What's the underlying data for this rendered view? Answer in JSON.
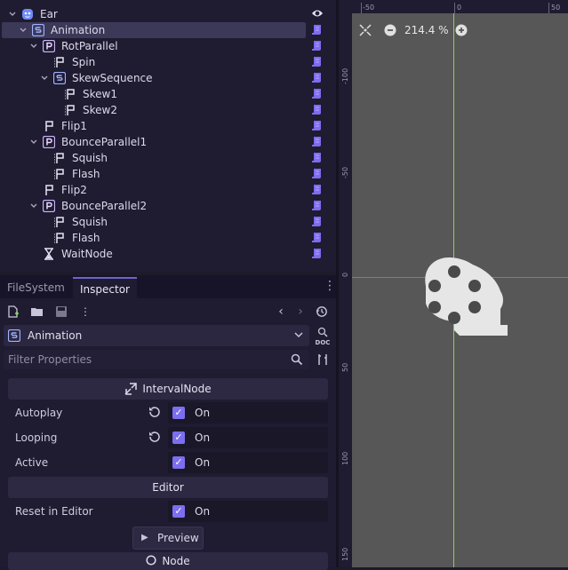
{
  "scene_tree": {
    "nodes": [
      {
        "label": "Ear",
        "depth": 0,
        "expand": "open",
        "icon": "root-face-icon"
      },
      {
        "label": "Animation",
        "depth": 1,
        "expand": "open",
        "icon": "sequence-icon",
        "selected": true
      },
      {
        "label": "RotParallel",
        "depth": 2,
        "expand": "open",
        "icon": "parallel-icon"
      },
      {
        "label": "Spin",
        "depth": 3,
        "expand": "none",
        "icon": "tween-flag-icon"
      },
      {
        "label": "SkewSequence",
        "depth": 3,
        "expand": "open",
        "icon": "sequence-icon"
      },
      {
        "label": "Skew1",
        "depth": 4,
        "expand": "none",
        "icon": "tween-flag-icon"
      },
      {
        "label": "Skew2",
        "depth": 4,
        "expand": "none",
        "icon": "tween-flag-icon"
      },
      {
        "label": "Flip1",
        "depth": 2,
        "expand": "none",
        "icon": "flag-icon"
      },
      {
        "label": "BounceParallel1",
        "depth": 2,
        "expand": "open",
        "icon": "parallel-icon"
      },
      {
        "label": "Squish",
        "depth": 3,
        "expand": "none",
        "icon": "tween-flag-icon"
      },
      {
        "label": "Flash",
        "depth": 3,
        "expand": "none",
        "icon": "tween-flag-icon"
      },
      {
        "label": "Flip2",
        "depth": 2,
        "expand": "none",
        "icon": "flag-icon"
      },
      {
        "label": "BounceParallel2",
        "depth": 2,
        "expand": "open",
        "icon": "parallel-icon"
      },
      {
        "label": "Squish",
        "depth": 3,
        "expand": "none",
        "icon": "tween-flag-icon"
      },
      {
        "label": "Flash",
        "depth": 3,
        "expand": "none",
        "icon": "tween-flag-icon"
      },
      {
        "label": "WaitNode",
        "depth": 2,
        "expand": "none",
        "icon": "hourglass-icon"
      }
    ]
  },
  "dock": {
    "tabs": [
      "FileSystem",
      "Inspector"
    ],
    "active_tab": "Inspector"
  },
  "inspector": {
    "object_name": "Animation",
    "filter_placeholder": "Filter Properties",
    "doc_label": "DOC",
    "sections": {
      "interval": "IntervalNode",
      "editor": "Editor",
      "node": "Node"
    },
    "properties": [
      {
        "label": "Autoplay",
        "value": "On",
        "checked": true,
        "revertable": true
      },
      {
        "label": "Looping",
        "value": "On",
        "checked": true,
        "revertable": true
      },
      {
        "label": "Active",
        "value": "On",
        "checked": true,
        "revertable": false
      }
    ],
    "editor_properties": [
      {
        "label": "Reset in Editor",
        "value": "On",
        "checked": true,
        "revertable": false
      }
    ],
    "preview_label": "Preview"
  },
  "viewport": {
    "zoom": "214.4 %",
    "ruler_top": [
      "-50",
      "0",
      "50"
    ],
    "ruler_left": [
      "-100",
      "-50",
      "0",
      "50",
      "100",
      "150"
    ],
    "background_color": "#575757",
    "x_axis_color": "#c85a78",
    "y_axis_color": "#8fcf5a",
    "sprite": "film-reel-icon"
  },
  "colors": {
    "accent": "#7c6ef0",
    "panel": "#1f1b31",
    "script_icon": "#7d6cf0"
  }
}
